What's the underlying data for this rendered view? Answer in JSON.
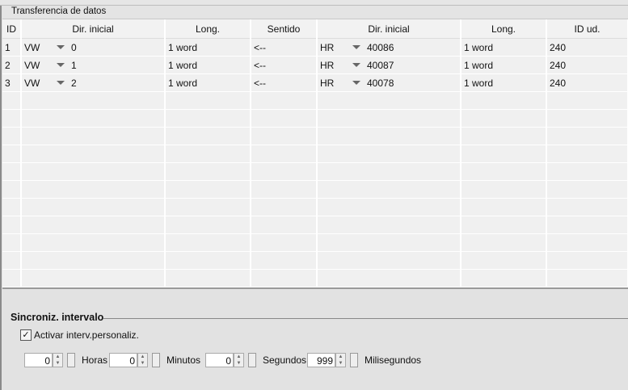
{
  "section_title": "Transferencia de datos",
  "columns": [
    "ID",
    "Dir. inicial",
    "Long.",
    "Sentido",
    "Dir. inicial",
    "Long.",
    "ID ud."
  ],
  "rows": [
    {
      "id": "1",
      "src_area": "VW",
      "src_addr": "0",
      "src_len": "1 word",
      "dir": "<--",
      "dst_area": "HR",
      "dst_addr": "40086",
      "dst_len": "1 word",
      "unit": "240"
    },
    {
      "id": "2",
      "src_area": "VW",
      "src_addr": "1",
      "src_len": "1 word",
      "dir": "<--",
      "dst_area": "HR",
      "dst_addr": "40087",
      "dst_len": "1 word",
      "unit": "240"
    },
    {
      "id": "3",
      "src_area": "VW",
      "src_addr": "2",
      "src_len": "1 word",
      "dir": "<--",
      "dst_area": "HR",
      "dst_addr": "40078",
      "dst_len": "1 word",
      "unit": "240"
    }
  ],
  "sync": {
    "title": "Sincroniz. intervalo",
    "checkbox_label": "Activar interv.personaliz.",
    "checked": true,
    "fields": [
      {
        "value": "0",
        "unit": "Horas"
      },
      {
        "value": "0",
        "unit": "Minutos"
      },
      {
        "value": "0",
        "unit": "Segundos"
      },
      {
        "value": "999",
        "unit": "Milisegundos"
      }
    ]
  }
}
